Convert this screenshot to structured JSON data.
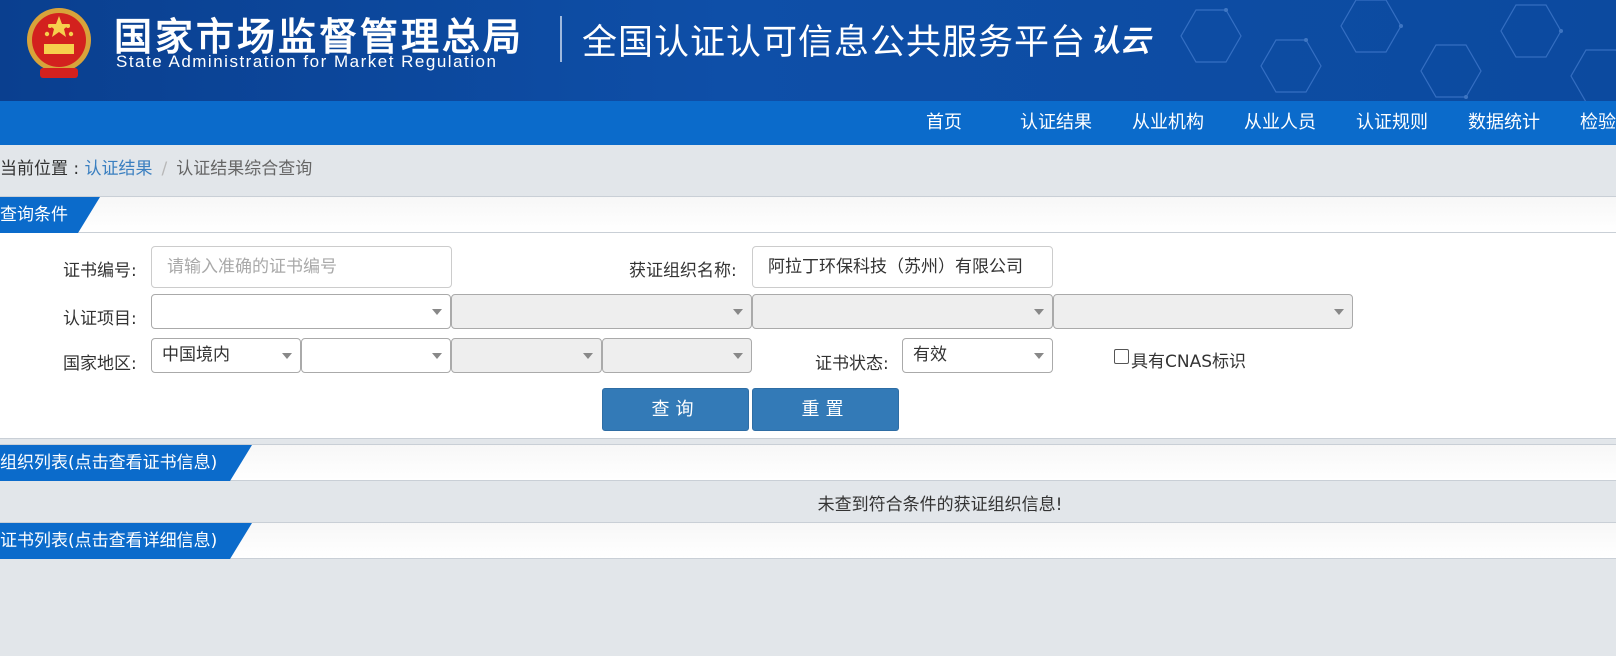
{
  "header": {
    "agency_cn": "国家市场监督管理总局",
    "agency_en": "State Administration  for  Market Regulation",
    "platform_title": "全国认证认可信息公共服务平台",
    "logo_text": "认云"
  },
  "nav": {
    "items": [
      "首页",
      "认证结果",
      "从业机构",
      "从业人员",
      "认证规则",
      "数据统计",
      "检验"
    ]
  },
  "breadcrumb": {
    "prefix": "当前位置 : ",
    "link": "认证结果",
    "separator": "/",
    "current": "认证结果综合查询"
  },
  "query_section": {
    "title": "查询条件",
    "cert_no_label": "证书编号:",
    "cert_no_placeholder": "请输入准确的证书编号",
    "org_name_label": "获证组织名称:",
    "org_name_value": "阿拉丁环保科技（苏州）有限公司",
    "project_label": "认证项目:",
    "region_label": "国家地区:",
    "region_value": "中国境内",
    "status_label": "证书状态:",
    "status_value": "有效",
    "cnas_label": "具有CNAS标识",
    "search_button": "查询",
    "reset_button": "重置"
  },
  "org_section": {
    "title": "组织列表(点击查看证书信息)",
    "empty_message": "未查到符合条件的获证组织信息!"
  },
  "cert_section": {
    "title": "证书列表(点击查看详细信息)"
  },
  "colors": {
    "banner": "#0e4fa8",
    "nav": "#0b6bcb",
    "button": "#337ab7",
    "link": "#3a7fc0"
  }
}
